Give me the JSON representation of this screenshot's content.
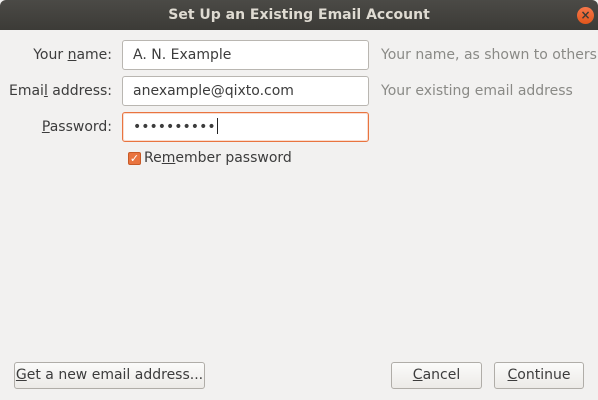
{
  "window": {
    "title": "Set Up an Existing Email Account",
    "close_glyph": "×"
  },
  "form": {
    "name": {
      "label_pre": "Your ",
      "label_mnemonic": "n",
      "label_post": "ame:",
      "value": "A. N. Example",
      "hint": "Your name, as shown to others"
    },
    "email": {
      "label_pre": "Emai",
      "label_mnemonic": "l",
      "label_post": " address:",
      "value": "anexample@qixto.com",
      "hint": "Your existing email address"
    },
    "password": {
      "label_pre": "",
      "label_mnemonic": "P",
      "label_post": "assword:",
      "value": "••••••••••"
    },
    "remember": {
      "checked": true,
      "check_glyph": "✓",
      "label_pre": "Re",
      "label_mnemonic": "m",
      "label_post": "ember password"
    }
  },
  "buttons": {
    "new_address": {
      "pre": "",
      "mnemonic": "G",
      "post": "et a new email address..."
    },
    "cancel": {
      "pre": "",
      "mnemonic": "C",
      "post": "ancel"
    },
    "continue": {
      "pre": "",
      "mnemonic": "C",
      "post": "ontinue"
    }
  },
  "colors": {
    "accent": "#e9743f",
    "titlebar": "#3c3b37",
    "background": "#f2f1f0"
  }
}
